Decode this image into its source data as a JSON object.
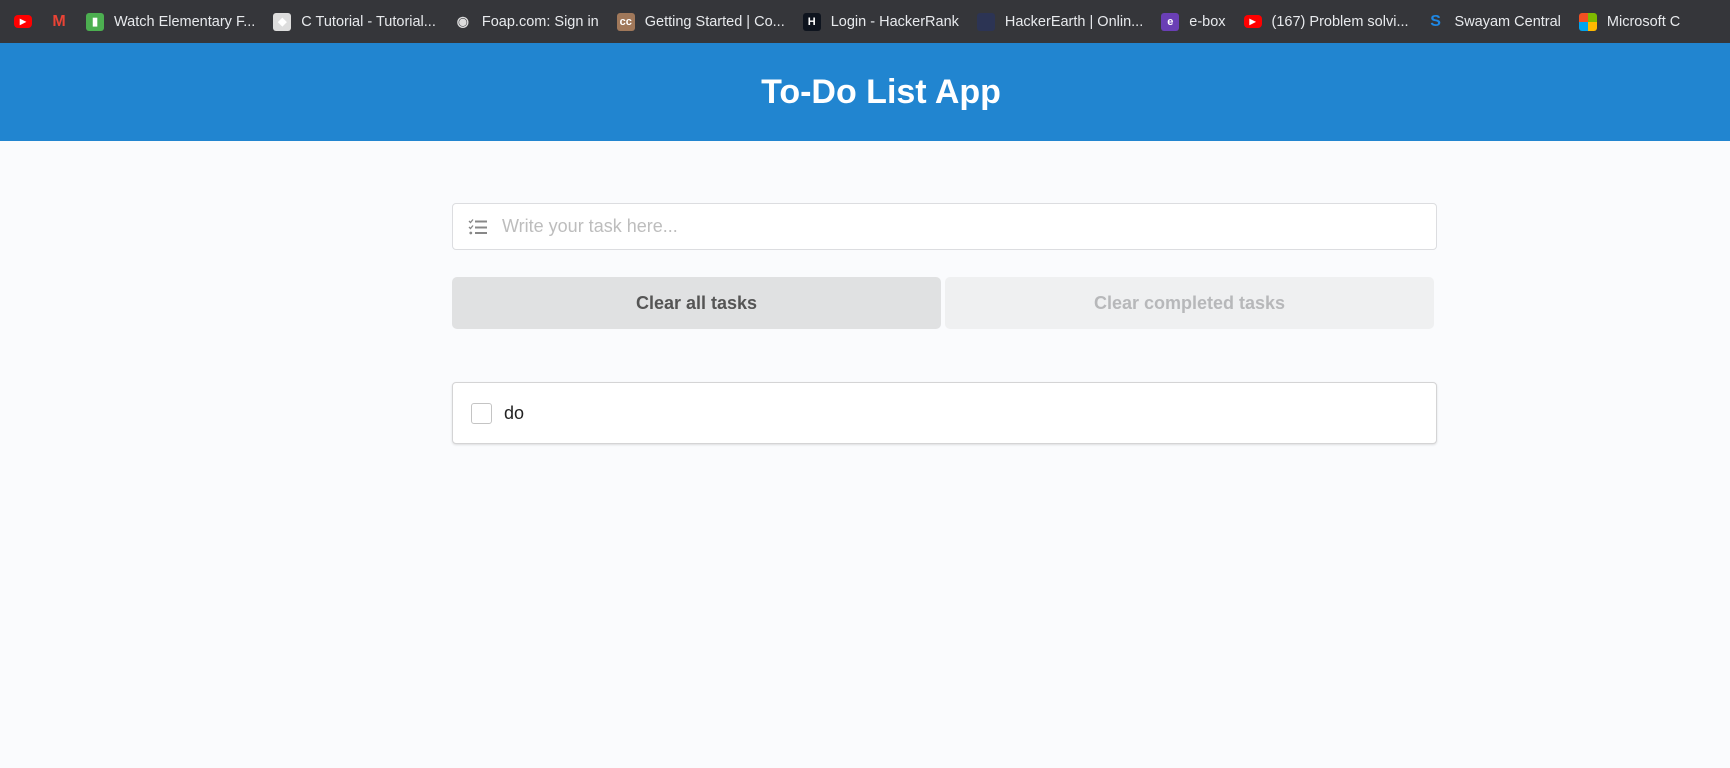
{
  "bookmarks": [
    {
      "label": "",
      "icon": "youtube-icon",
      "color": "#ff0000"
    },
    {
      "label": "",
      "icon": "gmail-icon",
      "color": "#ea4335"
    },
    {
      "label": "Watch Elementary F...",
      "icon": "bookmark-icon",
      "color": "#4caf50"
    },
    {
      "label": "C Tutorial - Tutorial...",
      "icon": "diamond-icon",
      "color": "#dddddd"
    },
    {
      "label": "Foap.com: Sign in",
      "icon": "camera-icon",
      "color": "#111111"
    },
    {
      "label": "Getting Started | Co...",
      "icon": "cc-icon",
      "color": "#a0785a"
    },
    {
      "label": "Login - HackerRank",
      "icon": "hackerrank-icon",
      "color": "#0e141e"
    },
    {
      "label": "HackerEarth | Onlin...",
      "icon": "hackerearth-icon",
      "color": "#2c3454"
    },
    {
      "label": "e-box",
      "icon": "ebox-icon",
      "color": "#6a3fb5"
    },
    {
      "label": "(167) Problem solvi...",
      "icon": "youtube-icon",
      "color": "#ff0000"
    },
    {
      "label": "Swayam Central",
      "icon": "swayam-icon",
      "color": "#1e88e5"
    },
    {
      "label": "Microsoft C",
      "icon": "microsoft-icon",
      "color": "#f25022"
    }
  ],
  "header": {
    "title": "To-Do List App",
    "color": "#2185d0"
  },
  "task_input": {
    "placeholder": "Write your task here...",
    "value": ""
  },
  "buttons": {
    "clear_all": "Clear all tasks",
    "clear_completed": "Clear completed tasks"
  },
  "tasks": [
    {
      "label": "do",
      "completed": false
    }
  ]
}
